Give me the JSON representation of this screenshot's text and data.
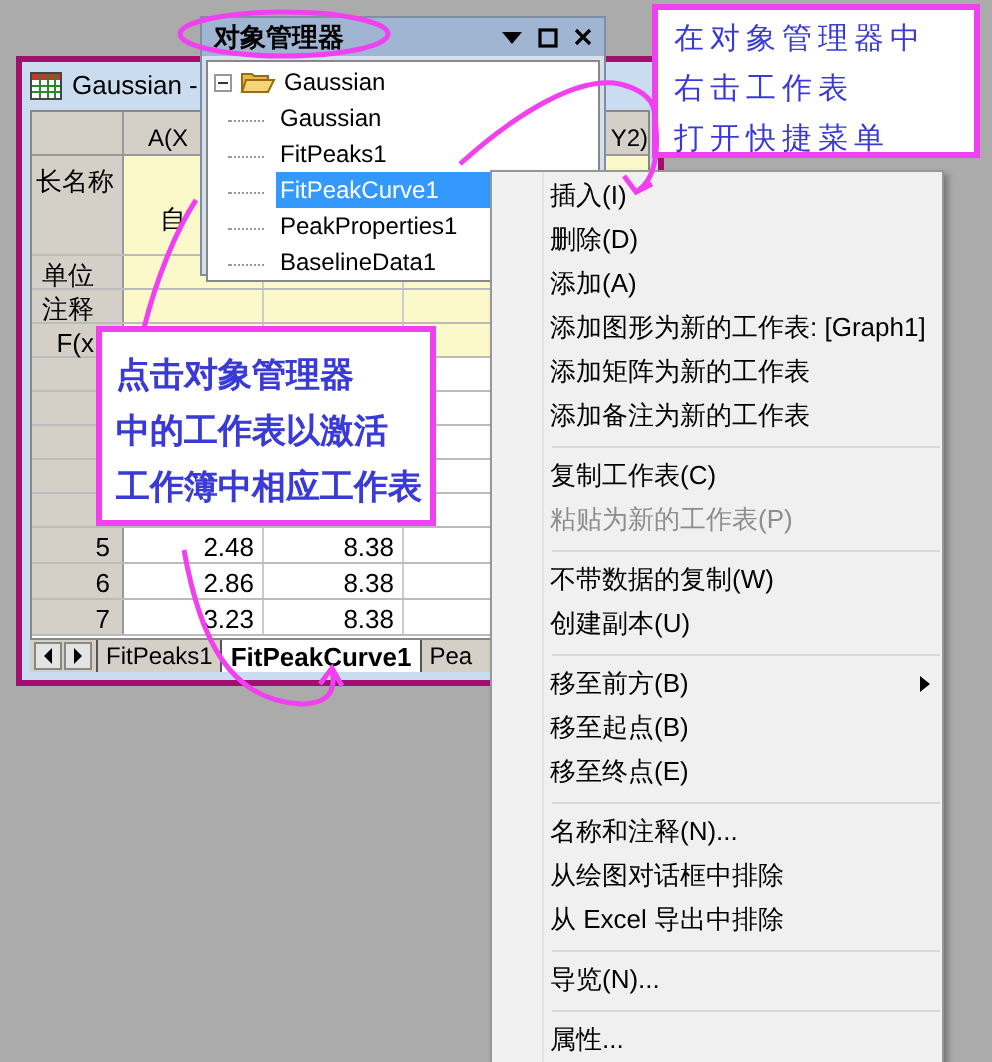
{
  "workbook": {
    "title": "Gaussian -",
    "column_headers": [
      "A(X",
      "Y2)"
    ],
    "row_labels": [
      "长名称",
      "单位",
      "注释",
      "F(x"
    ],
    "long_name_cell": "自",
    "rows": [
      {
        "label": "5",
        "cells": [
          "2.48",
          "8.38"
        ]
      },
      {
        "label": "6",
        "cells": [
          "2.86",
          "8.38"
        ]
      },
      {
        "label": "7",
        "cells": [
          "3.23",
          "8.38"
        ]
      }
    ],
    "sheet_tabs": [
      {
        "label": "FitPeaks1",
        "selected": false
      },
      {
        "label": "FitPeakCurve1",
        "selected": true
      },
      {
        "label": "Pea",
        "selected": false
      }
    ]
  },
  "object_manager": {
    "title": "对象管理器",
    "tree": [
      {
        "label": "Gaussian",
        "expanded": true,
        "children": [
          {
            "label": "Gaussian",
            "selected": false
          },
          {
            "label": "FitPeaks1",
            "selected": false
          },
          {
            "label": "FitPeakCurve1",
            "selected": true
          },
          {
            "label": "PeakProperties1",
            "selected": false
          },
          {
            "label": "BaselineData1",
            "selected": false
          }
        ]
      }
    ]
  },
  "context_menu": {
    "items": [
      {
        "kind": "item",
        "label": "插入(I)",
        "disabled": false,
        "submenu": false
      },
      {
        "kind": "item",
        "label": "删除(D)",
        "disabled": false,
        "submenu": false
      },
      {
        "kind": "item",
        "label": "添加(A)",
        "disabled": false,
        "submenu": false
      },
      {
        "kind": "item",
        "label": "添加图形为新的工作表: [Graph1]",
        "disabled": false,
        "submenu": false
      },
      {
        "kind": "item",
        "label": "添加矩阵为新的工作表",
        "disabled": false,
        "submenu": false
      },
      {
        "kind": "item",
        "label": "添加备注为新的工作表",
        "disabled": false,
        "submenu": false
      },
      {
        "kind": "separator"
      },
      {
        "kind": "item",
        "label": "复制工作表(C)",
        "disabled": false,
        "submenu": false
      },
      {
        "kind": "item",
        "label": "粘贴为新的工作表(P)",
        "disabled": true,
        "submenu": false
      },
      {
        "kind": "separator"
      },
      {
        "kind": "item",
        "label": "不带数据的复制(W)",
        "disabled": false,
        "submenu": false
      },
      {
        "kind": "item",
        "label": "创建副本(U)",
        "disabled": false,
        "submenu": false
      },
      {
        "kind": "separator"
      },
      {
        "kind": "item",
        "label": "移至前方(B)",
        "disabled": false,
        "submenu": true
      },
      {
        "kind": "item",
        "label": "移至起点(B)",
        "disabled": false,
        "submenu": false
      },
      {
        "kind": "item",
        "label": "移至终点(E)",
        "disabled": false,
        "submenu": false
      },
      {
        "kind": "separator"
      },
      {
        "kind": "item",
        "label": "名称和注释(N)...",
        "disabled": false,
        "submenu": false
      },
      {
        "kind": "item",
        "label": "从绘图对话框中排除",
        "disabled": false,
        "submenu": false
      },
      {
        "kind": "item",
        "label": "从 Excel 导出中排除",
        "disabled": false,
        "submenu": false
      },
      {
        "kind": "separator"
      },
      {
        "kind": "item",
        "label": "导览(N)...",
        "disabled": false,
        "submenu": false
      },
      {
        "kind": "separator"
      },
      {
        "kind": "item",
        "label": "属性...",
        "disabled": false,
        "submenu": false
      }
    ]
  },
  "callouts": [
    {
      "lines": [
        "在对象管理器中",
        "右击工作表",
        "打开快捷菜单"
      ]
    },
    {
      "lines": [
        "点击对象管理器",
        "中的工作表以激活",
        "工作簿中相应工作表"
      ]
    }
  ]
}
